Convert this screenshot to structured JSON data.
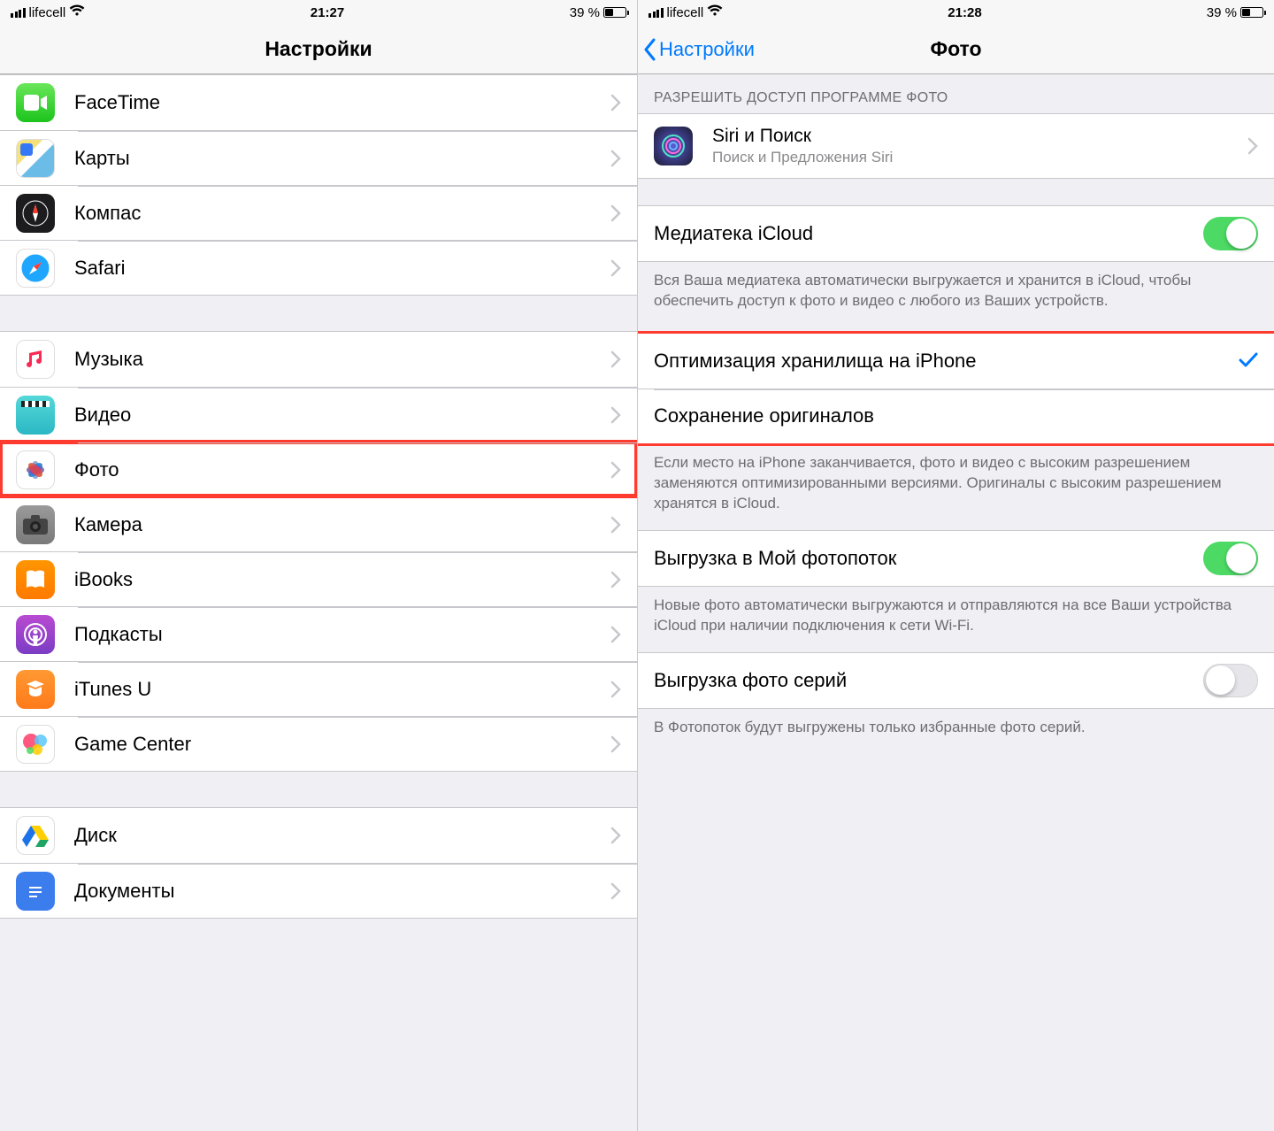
{
  "left": {
    "status": {
      "carrier": "lifecell",
      "time": "21:27",
      "battery_text": "39 %"
    },
    "nav_title": "Настройки",
    "group1": [
      {
        "label": "FaceTime"
      },
      {
        "label": "Карты"
      },
      {
        "label": "Компас"
      },
      {
        "label": "Safari"
      }
    ],
    "group2": [
      {
        "label": "Музыка"
      },
      {
        "label": "Видео"
      },
      {
        "label": "Фото"
      },
      {
        "label": "Камера"
      },
      {
        "label": "iBooks"
      },
      {
        "label": "Подкасты"
      },
      {
        "label": "iTunes U"
      },
      {
        "label": "Game Center"
      }
    ],
    "group3": [
      {
        "label": "Диск"
      },
      {
        "label": "Документы"
      }
    ]
  },
  "right": {
    "status": {
      "carrier": "lifecell",
      "time": "21:28",
      "battery_text": "39 %"
    },
    "nav_back": "Настройки",
    "nav_title": "Фото",
    "section_access_header": "РАЗРЕШИТЬ ДОСТУП ПРОГРАММЕ ФОТО",
    "siri_title": "Siri и Поиск",
    "siri_sub": "Поиск и Предложения Siri",
    "icloud_label": "Медиатека iCloud",
    "icloud_footer": "Вся Ваша медиатека автоматически выгружается и хранится в iCloud, чтобы обеспечить доступ к фото и видео с любого из Ваших устройств.",
    "optimize_label": "Оптимизация хранилища на iPhone",
    "originals_label": "Сохранение оригиналов",
    "optimize_footer": "Если место на iPhone заканчивается, фото и видео с высоким разрешением заменяются оптимизированными версиями. Оригиналы с высоким разрешением хранятся в iCloud.",
    "stream_label": "Выгрузка в Мой фотопоток",
    "stream_footer": "Новые фото автоматически выгружаются и отправляются на все Ваши устройства iCloud при наличии подключения к сети Wi-Fi.",
    "burst_label": "Выгрузка фото серий",
    "burst_footer": "В Фотопоток будут выгружены только избранные фото серий."
  }
}
